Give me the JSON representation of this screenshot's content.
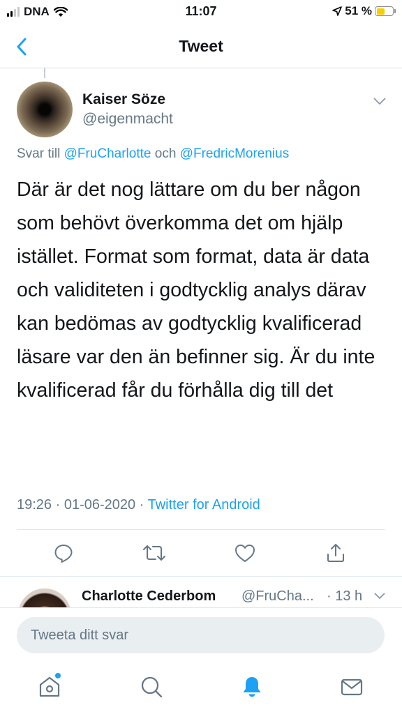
{
  "status_bar": {
    "carrier": "DNA",
    "time": "11:07",
    "battery_percent": "51 %",
    "battery_level": 0.51
  },
  "nav": {
    "title": "Tweet",
    "back_icon": "chevron-left-icon"
  },
  "tweet": {
    "author_name": "Kaiser Söze",
    "author_handle": "@eigenmacht",
    "reply_prefix": "Svar till",
    "reply_mention_1": "@FruCharlotte",
    "reply_joiner": "och",
    "reply_mention_2": "@FredricMorenius",
    "text": "Där är det nog lättare om du ber någon som behövt överkomma det om hjälp istället. Format som format, data är data och validiteten i godtycklig analys därav kan bedömas av godtycklig kvalificerad läsare var den än befinner sig. Är du inte kvalificerad får du förhålla dig till det",
    "time": "19:26",
    "date": "01-06-2020",
    "separator": "·",
    "client": "Twitter for Android"
  },
  "actions": [
    "reply-icon",
    "retweet-icon",
    "like-icon",
    "share-icon"
  ],
  "next_reply": {
    "author_name": "Charlotte Cederbom",
    "author_handle": "@FruCha...",
    "age": "· 13 h"
  },
  "compose": {
    "placeholder": "Tweeta ditt svar"
  },
  "tab_bar": [
    "home-icon",
    "search-icon",
    "notifications-icon",
    "messages-icon"
  ],
  "colors": {
    "accent": "#1da1f2",
    "secondary_text": "#657786",
    "primary_text": "#14171a",
    "battery": "#f7ce00"
  }
}
